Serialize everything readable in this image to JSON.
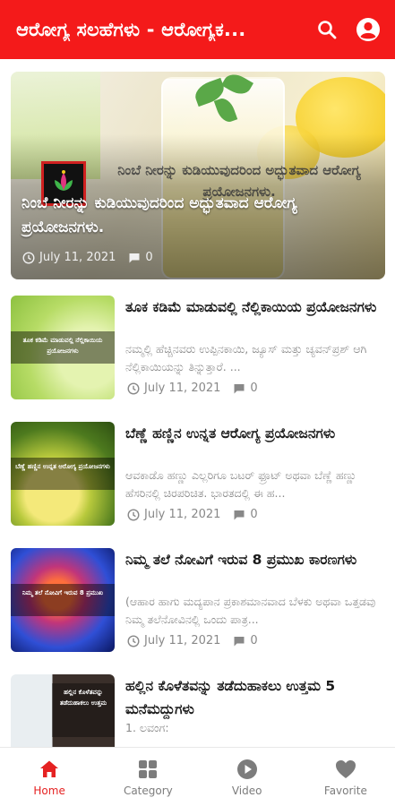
{
  "appbar": {
    "title": "ಆರೋಗ್ಯ ಸಲಹೆಗಳು - ಆರೋಗ್ಯಕ...",
    "search_icon": "search-icon",
    "account_icon": "account-circle-icon",
    "color": "#f41a1a"
  },
  "featured": {
    "image_text": "ನಿಂಬೆ ನೀರನ್ನು ಕುಡಿಯುವುದರಿಂದ ಅದ್ಭುತವಾದ ಆರೋಗ್ಯ ಪ್ರಯೋಜನಗಳು.",
    "title": "ನಿಂಬೆ ನೀರನ್ನು ಕುಡಿಯುವುದರಿಂದ ಅದ್ಭುತವಾದ ಆರೋಗ್ಯ ಪ್ರಯೋಜನಗಳು.",
    "date": "July 11, 2021",
    "comments": "0"
  },
  "posts": [
    {
      "title": "ತೂಕ ಕಡಿಮೆ ಮಾಡುವಲ್ಲಿ ನೆಲ್ಲಿಕಾಯಿಯ ಪ್ರಯೋಜನಗಳು",
      "excerpt": "ನಮ್ಮಲ್ಲಿ ಹೆಚ್ಚಿನವರು ಉಪ್ಪಿನಕಾಯಿ, ಜ್ಯೂಸ್ ಮತ್ತು ಚ್ಯವನ್‌ಪ್ರಶ್ ಆಗಿ ನೆಲ್ಲಿಕಾಯಿಯನ್ನು ತಿನ್ನುತ್ತಾರೆ. ...",
      "thumb_text": "ತೂಕ ಕಡಿಮೆ ಮಾಡುವಲ್ಲಿ ನೆಲ್ಲಿಕಾಯಿಯ ಪ್ರಯೋಜನಗಳು",
      "date": "July 11, 2021",
      "comments": "0"
    },
    {
      "title": "ಬೆಣ್ಣೆ ಹಣ್ಣಿನ ಉನ್ನತ ಆರೋಗ್ಯ ಪ್ರಯೋಜನಗಳು",
      "excerpt": "ಆವಕಾಡೊ ಹಣ್ಣು ಎಲ್ಲರಿಗೂ ಬಟರ್ ಫ್ರೂಟ್ ಅಥವಾ ಬೆಣ್ಣೆ ಹಣ್ಣು ಹೆಸರಿನಲ್ಲಿ ಚಿರಪರಿಚಿತ. ಭಾರತದಲ್ಲಿ ಈ ಹ...",
      "thumb_text": "ಬೆಣ್ಣೆ ಹಣ್ಣಿನ ಉನ್ನತ ಆರೋಗ್ಯ ಪ್ರಯೋಜನಗಳು",
      "date": "July 11, 2021",
      "comments": "0"
    },
    {
      "title": "ನಿಮ್ಮ ತಲೆ ನೋವಿಗೆ ಇರುವ 8 ಪ್ರಮುಖ ಕಾರಣಗಳು",
      "excerpt": "(ಆಹಾರ ಹಾಗು ಮದ್ಯಪಾನ ಪ್ರಕಾಶಮಾನವಾದ ಬೆಳಕು ಅಥವಾ ಒತ್ತಡವು ನಿಮ್ಮ ತಲೆನೋವಿನಲ್ಲಿ ಒಂದು ಪಾತ್ರ...",
      "thumb_text": "ನಿಮ್ಮ ತಲೆ ನೋವಿಗೆ ಇರುವ 8 ಪ್ರಮುಖ",
      "date": "July 11, 2021",
      "comments": "0"
    },
    {
      "title": "ಹಲ್ಲಿನ ಕೊಳೆತವನ್ನು ತಡೆದುಹಾಕಲು ಉತ್ತಮ 5 ಮನೆಮದ್ದುಗಳು",
      "excerpt": "1. ಲವಂಗ:",
      "thumb_text": "ಹಲ್ಲಿನ ಕೊಳೆತವನ್ನು ತಡೆದುಹಾಕಲು ಉತ್ತಮ",
      "date": "",
      "comments": ""
    }
  ],
  "nav": {
    "items": [
      {
        "label": "Home",
        "icon": "home-icon",
        "active": true
      },
      {
        "label": "Category",
        "icon": "category-icon",
        "active": false
      },
      {
        "label": "Video",
        "icon": "play-circle-icon",
        "active": false
      },
      {
        "label": "Favorite",
        "icon": "heart-icon",
        "active": false
      }
    ],
    "active_color": "#e52222",
    "inactive_color": "#7c7c7c"
  }
}
